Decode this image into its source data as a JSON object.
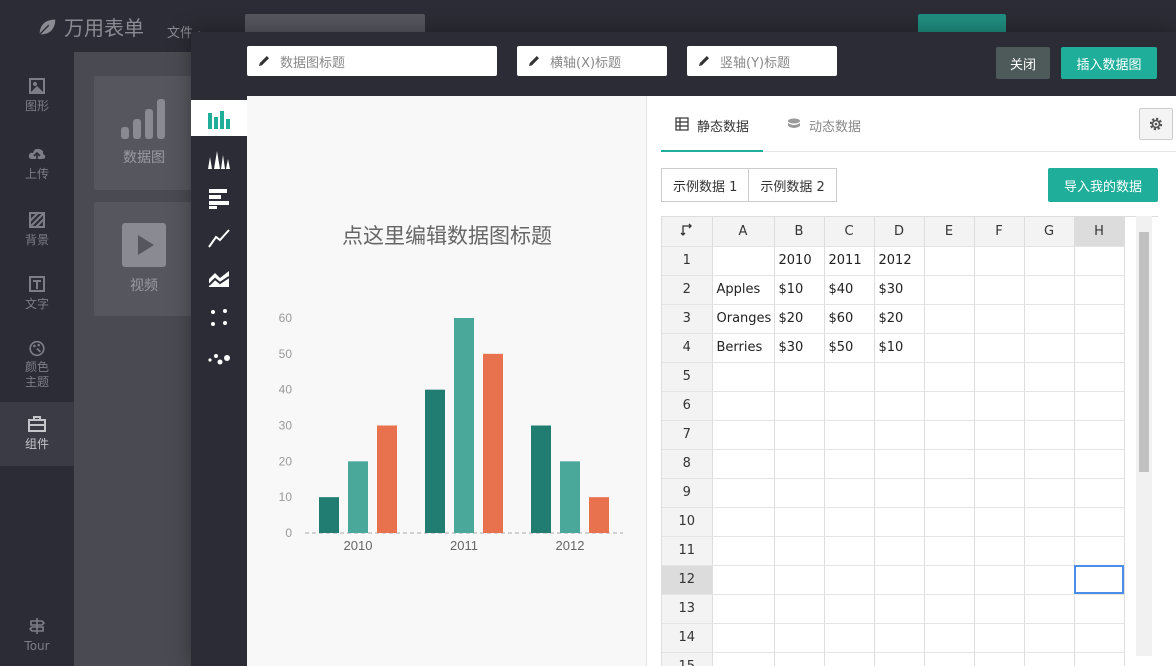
{
  "app": {
    "logo_text": "万用表单",
    "menu_file": "文件 ·",
    "sidebar": [
      {
        "label": "图形",
        "icon": "image-icon"
      },
      {
        "label": "上传",
        "icon": "cloud-upload-icon"
      },
      {
        "label": "背景",
        "icon": "pattern-icon"
      },
      {
        "label": "文字",
        "icon": "text-icon"
      },
      {
        "label": "颜色\n主题",
        "icon": "palette-icon"
      },
      {
        "label": "组件",
        "icon": "toolbox-icon"
      },
      {
        "label": "Tour",
        "icon": "signpost-icon"
      }
    ],
    "panel_tiles": [
      {
        "label": "数据图",
        "icon": "bar-chart-icon"
      },
      {
        "label": "视频",
        "icon": "play-icon"
      }
    ]
  },
  "modal": {
    "chart_title_placeholder": "数据图标题",
    "x_title_placeholder": "横轴(X)标题",
    "y_title_placeholder": "竖轴(Y)标题",
    "close_label": "关闭",
    "insert_label": "插入数据图",
    "chart_types": [
      "bar-chart-icon",
      "histogram-icon",
      "horizontal-bar-icon",
      "line-chart-icon",
      "area-chart-icon",
      "scatter-icon",
      "bubble-icon"
    ],
    "tabs": {
      "static": "静态数据",
      "dynamic": "动态数据"
    },
    "sample1": "示例数据 1",
    "sample2": "示例数据 2",
    "import_label": "导入我的数据",
    "colors": {
      "teal": "#1fae9a",
      "dark": "#2b2c35"
    }
  },
  "chart_data": {
    "type": "bar",
    "title": "点这里编辑数据图标题",
    "categories": [
      "2010",
      "2011",
      "2012"
    ],
    "series": [
      {
        "name": "Apples",
        "values": [
          10,
          40,
          30
        ],
        "color": "#217d71"
      },
      {
        "name": "Oranges",
        "values": [
          20,
          60,
          20
        ],
        "color": "#4aa89a"
      },
      {
        "name": "Berries",
        "values": [
          30,
          50,
          10
        ],
        "color": "#e8714e"
      }
    ],
    "ylim": [
      0,
      60
    ],
    "yticks": [
      0,
      10,
      20,
      30,
      40,
      50,
      60
    ],
    "legend": "bottom",
    "grid": false
  },
  "sheet": {
    "columns": [
      "A",
      "B",
      "C",
      "D",
      "E",
      "F",
      "G",
      "H"
    ],
    "selected_col": "H",
    "selected_row": 12,
    "rows": [
      [
        "",
        "2010",
        "2011",
        "2012",
        "",
        "",
        "",
        ""
      ],
      [
        "Apples",
        "$10",
        "$40",
        "$30",
        "",
        "",
        "",
        ""
      ],
      [
        "Oranges",
        "$20",
        "$60",
        "$20",
        "",
        "",
        "",
        ""
      ],
      [
        "Berries",
        "$30",
        "$50",
        "$10",
        "",
        "",
        "",
        ""
      ],
      [
        "",
        "",
        "",
        "",
        "",
        "",
        "",
        ""
      ],
      [
        "",
        "",
        "",
        "",
        "",
        "",
        "",
        ""
      ],
      [
        "",
        "",
        "",
        "",
        "",
        "",
        "",
        ""
      ],
      [
        "",
        "",
        "",
        "",
        "",
        "",
        "",
        ""
      ],
      [
        "",
        "",
        "",
        "",
        "",
        "",
        "",
        ""
      ],
      [
        "",
        "",
        "",
        "",
        "",
        "",
        "",
        ""
      ],
      [
        "",
        "",
        "",
        "",
        "",
        "",
        "",
        ""
      ],
      [
        "",
        "",
        "",
        "",
        "",
        "",
        "",
        ""
      ],
      [
        "",
        "",
        "",
        "",
        "",
        "",
        "",
        ""
      ],
      [
        "",
        "",
        "",
        "",
        "",
        "",
        "",
        ""
      ],
      [
        "",
        "",
        "",
        "",
        "",
        "",
        "",
        ""
      ]
    ]
  }
}
